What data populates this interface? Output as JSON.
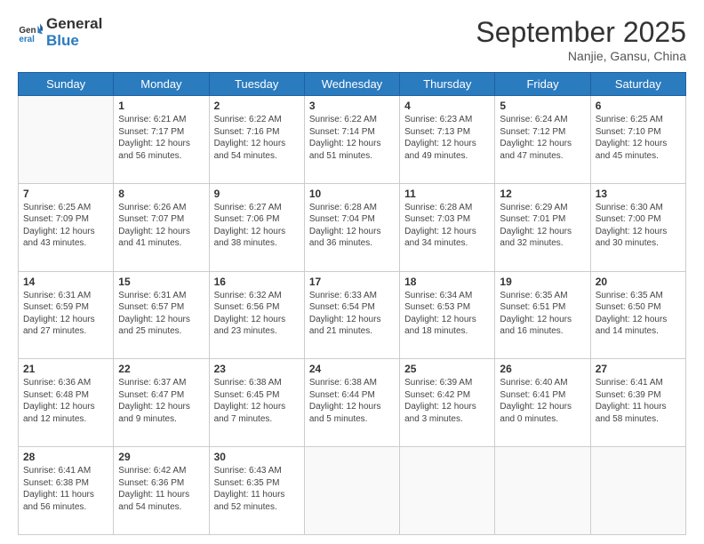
{
  "header": {
    "logo_line1": "General",
    "logo_line2": "Blue",
    "month": "September 2025",
    "location": "Nanjie, Gansu, China"
  },
  "weekdays": [
    "Sunday",
    "Monday",
    "Tuesday",
    "Wednesday",
    "Thursday",
    "Friday",
    "Saturday"
  ],
  "weeks": [
    [
      {
        "day": "",
        "lines": []
      },
      {
        "day": "1",
        "lines": [
          "Sunrise: 6:21 AM",
          "Sunset: 7:17 PM",
          "Daylight: 12 hours",
          "and 56 minutes."
        ]
      },
      {
        "day": "2",
        "lines": [
          "Sunrise: 6:22 AM",
          "Sunset: 7:16 PM",
          "Daylight: 12 hours",
          "and 54 minutes."
        ]
      },
      {
        "day": "3",
        "lines": [
          "Sunrise: 6:22 AM",
          "Sunset: 7:14 PM",
          "Daylight: 12 hours",
          "and 51 minutes."
        ]
      },
      {
        "day": "4",
        "lines": [
          "Sunrise: 6:23 AM",
          "Sunset: 7:13 PM",
          "Daylight: 12 hours",
          "and 49 minutes."
        ]
      },
      {
        "day": "5",
        "lines": [
          "Sunrise: 6:24 AM",
          "Sunset: 7:12 PM",
          "Daylight: 12 hours",
          "and 47 minutes."
        ]
      },
      {
        "day": "6",
        "lines": [
          "Sunrise: 6:25 AM",
          "Sunset: 7:10 PM",
          "Daylight: 12 hours",
          "and 45 minutes."
        ]
      }
    ],
    [
      {
        "day": "7",
        "lines": [
          "Sunrise: 6:25 AM",
          "Sunset: 7:09 PM",
          "Daylight: 12 hours",
          "and 43 minutes."
        ]
      },
      {
        "day": "8",
        "lines": [
          "Sunrise: 6:26 AM",
          "Sunset: 7:07 PM",
          "Daylight: 12 hours",
          "and 41 minutes."
        ]
      },
      {
        "day": "9",
        "lines": [
          "Sunrise: 6:27 AM",
          "Sunset: 7:06 PM",
          "Daylight: 12 hours",
          "and 38 minutes."
        ]
      },
      {
        "day": "10",
        "lines": [
          "Sunrise: 6:28 AM",
          "Sunset: 7:04 PM",
          "Daylight: 12 hours",
          "and 36 minutes."
        ]
      },
      {
        "day": "11",
        "lines": [
          "Sunrise: 6:28 AM",
          "Sunset: 7:03 PM",
          "Daylight: 12 hours",
          "and 34 minutes."
        ]
      },
      {
        "day": "12",
        "lines": [
          "Sunrise: 6:29 AM",
          "Sunset: 7:01 PM",
          "Daylight: 12 hours",
          "and 32 minutes."
        ]
      },
      {
        "day": "13",
        "lines": [
          "Sunrise: 6:30 AM",
          "Sunset: 7:00 PM",
          "Daylight: 12 hours",
          "and 30 minutes."
        ]
      }
    ],
    [
      {
        "day": "14",
        "lines": [
          "Sunrise: 6:31 AM",
          "Sunset: 6:59 PM",
          "Daylight: 12 hours",
          "and 27 minutes."
        ]
      },
      {
        "day": "15",
        "lines": [
          "Sunrise: 6:31 AM",
          "Sunset: 6:57 PM",
          "Daylight: 12 hours",
          "and 25 minutes."
        ]
      },
      {
        "day": "16",
        "lines": [
          "Sunrise: 6:32 AM",
          "Sunset: 6:56 PM",
          "Daylight: 12 hours",
          "and 23 minutes."
        ]
      },
      {
        "day": "17",
        "lines": [
          "Sunrise: 6:33 AM",
          "Sunset: 6:54 PM",
          "Daylight: 12 hours",
          "and 21 minutes."
        ]
      },
      {
        "day": "18",
        "lines": [
          "Sunrise: 6:34 AM",
          "Sunset: 6:53 PM",
          "Daylight: 12 hours",
          "and 18 minutes."
        ]
      },
      {
        "day": "19",
        "lines": [
          "Sunrise: 6:35 AM",
          "Sunset: 6:51 PM",
          "Daylight: 12 hours",
          "and 16 minutes."
        ]
      },
      {
        "day": "20",
        "lines": [
          "Sunrise: 6:35 AM",
          "Sunset: 6:50 PM",
          "Daylight: 12 hours",
          "and 14 minutes."
        ]
      }
    ],
    [
      {
        "day": "21",
        "lines": [
          "Sunrise: 6:36 AM",
          "Sunset: 6:48 PM",
          "Daylight: 12 hours",
          "and 12 minutes."
        ]
      },
      {
        "day": "22",
        "lines": [
          "Sunrise: 6:37 AM",
          "Sunset: 6:47 PM",
          "Daylight: 12 hours",
          "and 9 minutes."
        ]
      },
      {
        "day": "23",
        "lines": [
          "Sunrise: 6:38 AM",
          "Sunset: 6:45 PM",
          "Daylight: 12 hours",
          "and 7 minutes."
        ]
      },
      {
        "day": "24",
        "lines": [
          "Sunrise: 6:38 AM",
          "Sunset: 6:44 PM",
          "Daylight: 12 hours",
          "and 5 minutes."
        ]
      },
      {
        "day": "25",
        "lines": [
          "Sunrise: 6:39 AM",
          "Sunset: 6:42 PM",
          "Daylight: 12 hours",
          "and 3 minutes."
        ]
      },
      {
        "day": "26",
        "lines": [
          "Sunrise: 6:40 AM",
          "Sunset: 6:41 PM",
          "Daylight: 12 hours",
          "and 0 minutes."
        ]
      },
      {
        "day": "27",
        "lines": [
          "Sunrise: 6:41 AM",
          "Sunset: 6:39 PM",
          "Daylight: 11 hours",
          "and 58 minutes."
        ]
      }
    ],
    [
      {
        "day": "28",
        "lines": [
          "Sunrise: 6:41 AM",
          "Sunset: 6:38 PM",
          "Daylight: 11 hours",
          "and 56 minutes."
        ]
      },
      {
        "day": "29",
        "lines": [
          "Sunrise: 6:42 AM",
          "Sunset: 6:36 PM",
          "Daylight: 11 hours",
          "and 54 minutes."
        ]
      },
      {
        "day": "30",
        "lines": [
          "Sunrise: 6:43 AM",
          "Sunset: 6:35 PM",
          "Daylight: 11 hours",
          "and 52 minutes."
        ]
      },
      {
        "day": "",
        "lines": []
      },
      {
        "day": "",
        "lines": []
      },
      {
        "day": "",
        "lines": []
      },
      {
        "day": "",
        "lines": []
      }
    ]
  ]
}
